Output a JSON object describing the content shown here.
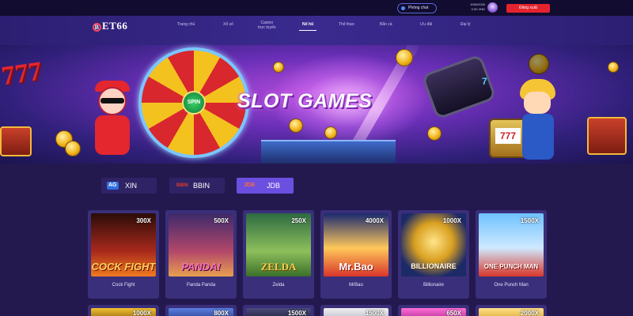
{
  "topbar": {
    "support_label": "Phòng chat",
    "user_line1": "1066/2026",
    "user_line2": "0.00 VND",
    "logout_label": "Đăng xuất"
  },
  "brand": {
    "logo_letter": "B",
    "logo_text": "ET66"
  },
  "nav": {
    "items": [
      {
        "label": "Trang chủ"
      },
      {
        "label": "Xổ số"
      },
      {
        "label": "Casino\ntrực tuyến"
      },
      {
        "label": "Nổ hũ"
      },
      {
        "label": "Thể thao"
      },
      {
        "label": "Bắn cá"
      },
      {
        "label": "Ưu đãi"
      },
      {
        "label": "Đại lý"
      }
    ],
    "active_index": 3
  },
  "banner": {
    "title": "SLOT GAMES",
    "wheel_center": "SPIN",
    "seven_left": "777",
    "seven_right": "7",
    "slot_win": "777"
  },
  "providers": [
    {
      "icon": "AG",
      "label": "XIN"
    },
    {
      "icon": "BBIN",
      "label": "BBIN"
    },
    {
      "icon": "JDB",
      "label": "JDB",
      "selected": true
    }
  ],
  "games": [
    {
      "name": "Cock Fight",
      "multiplier": "300X",
      "art_text": "COCK FIGHT"
    },
    {
      "name": "Panda Panda",
      "multiplier": "500X",
      "art_text": "PANDA!"
    },
    {
      "name": "Zelda",
      "multiplier": "250X",
      "art_text": "ZELDA"
    },
    {
      "name": "MrBao",
      "multiplier": "4000X",
      "art_text": "Mr.Bao"
    },
    {
      "name": "Billionaire",
      "multiplier": "1000X",
      "art_text": "BILLIONAIRE"
    },
    {
      "name": "One Punch Man",
      "multiplier": "1500X",
      "art_text": "ONE PUNCH MAN"
    }
  ],
  "games_row2": [
    {
      "multiplier": "1000X"
    },
    {
      "multiplier": "800X"
    },
    {
      "multiplier": "1500X"
    },
    {
      "multiplier": "1500X"
    },
    {
      "multiplier": "650X"
    },
    {
      "multiplier": "2000X"
    }
  ],
  "colors": {
    "background": "#24194f",
    "nav": "#3a2a8f",
    "accent_red": "#e5232e",
    "tab_selected": "#6b4fe0",
    "card": "#3a2f7a"
  }
}
